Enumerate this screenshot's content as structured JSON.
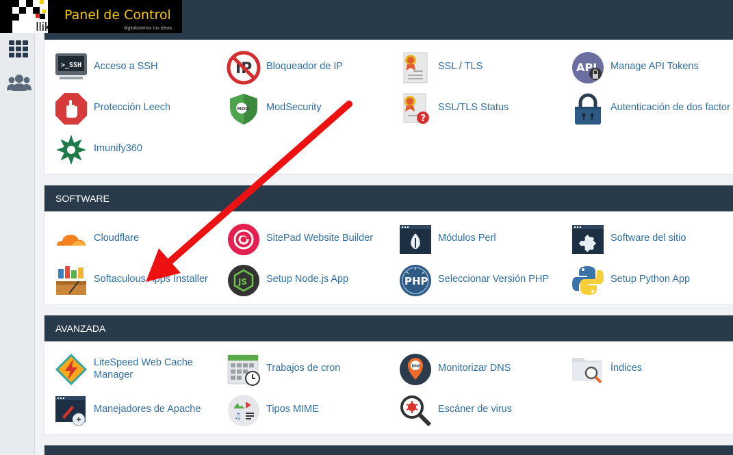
{
  "brand": {
    "logo_text": "llika",
    "title": "Panel de Control",
    "tagline": "digitalizamos tus ideas"
  },
  "sidebar": {
    "items": [
      {
        "icon": "grid-icon"
      },
      {
        "icon": "users-icon"
      }
    ]
  },
  "security": {
    "items": [
      {
        "label": "Acceso a SSH",
        "icon": "ssh-terminal-icon"
      },
      {
        "label": "Bloqueador de IP",
        "icon": "ip-blocker-icon"
      },
      {
        "label": "SSL / TLS",
        "icon": "ssl-certificate-icon"
      },
      {
        "label": "Manage API Tokens",
        "icon": "api-token-icon"
      },
      {
        "label": "Protección Leech",
        "icon": "leech-hand-icon"
      },
      {
        "label": "ModSecurity",
        "icon": "modsecurity-shield-icon"
      },
      {
        "label": "SSL/TLS Status",
        "icon": "ssl-status-icon"
      },
      {
        "label": "Autenticación de dos factor",
        "icon": "padlock-icon"
      },
      {
        "label": "Imunify360",
        "icon": "imunify360-icon"
      }
    ]
  },
  "software": {
    "header": "SOFTWARE",
    "items": [
      {
        "label": "Cloudflare",
        "icon": "cloudflare-icon"
      },
      {
        "label": "SitePad Website Builder",
        "icon": "sitepad-icon"
      },
      {
        "label": "Módulos Perl",
        "icon": "perl-modules-icon"
      },
      {
        "label": "Software del sitio",
        "icon": "puzzle-icon"
      },
      {
        "label": "Softaculous Apps Installer",
        "icon": "softaculous-icon"
      },
      {
        "label": "Setup Node.js App",
        "icon": "nodejs-icon"
      },
      {
        "label": "Seleccionar Versión PHP",
        "icon": "php-icon"
      },
      {
        "label": "Setup Python App",
        "icon": "python-icon"
      }
    ]
  },
  "avanzada": {
    "header": "AVANZADA",
    "items": [
      {
        "label": "LiteSpeed Web Cache Manager",
        "icon": "litespeed-icon"
      },
      {
        "label": "Trabajos de cron",
        "icon": "cron-calendar-icon"
      },
      {
        "label": "Monitorizar DNS",
        "icon": "dns-monitor-icon"
      },
      {
        "label": "Índices",
        "icon": "folder-search-icon"
      },
      {
        "label": "Manejadores de Apache",
        "icon": "apache-handlers-icon"
      },
      {
        "label": "Tipos MIME",
        "icon": "mime-types-icon"
      },
      {
        "label": "Escáner de virus",
        "icon": "virus-scanner-icon"
      }
    ]
  },
  "colors": {
    "header_bg": "#293a4a",
    "link": "#2f6fa6",
    "arrow": "#ee1111",
    "brand_yellow": "#f5c400"
  }
}
